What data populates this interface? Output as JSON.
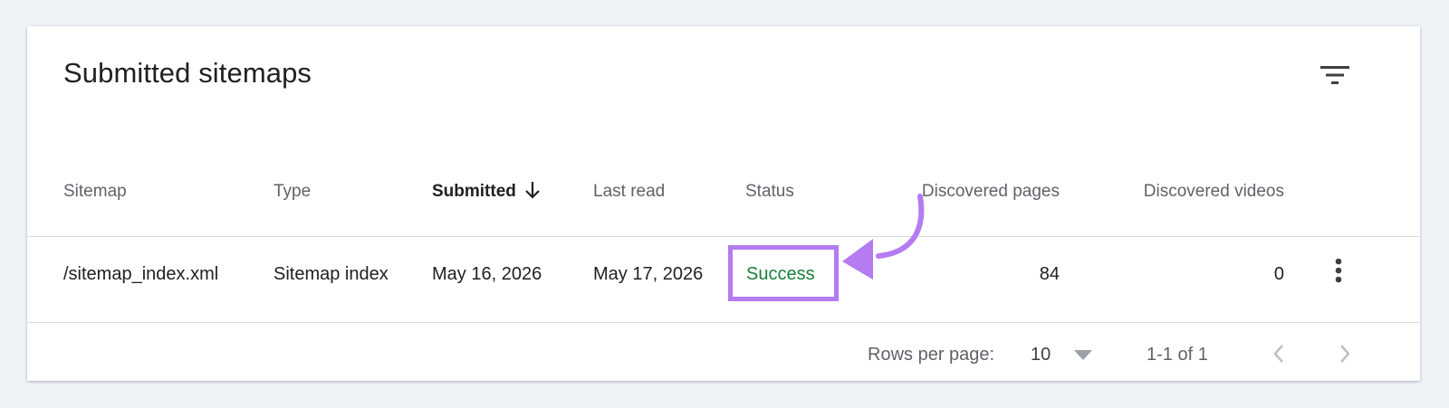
{
  "card": {
    "title": "Submitted sitemaps",
    "filter_icon": "filter-list-icon"
  },
  "table": {
    "columns": [
      {
        "label": "Sitemap"
      },
      {
        "label": "Type"
      },
      {
        "label": "Submitted",
        "sorted": "descending"
      },
      {
        "label": "Last read"
      },
      {
        "label": "Status"
      },
      {
        "label": "Discovered pages"
      },
      {
        "label": "Discovered videos"
      }
    ],
    "rows": [
      {
        "sitemap": "/sitemap_index.xml",
        "type": "Sitemap index",
        "submitted": "May 16, 2026",
        "last_read": "May 17, 2026",
        "status": "Success",
        "discovered_pages": "84",
        "discovered_videos": "0"
      }
    ]
  },
  "pagination": {
    "rows_per_page_label": "Rows per page:",
    "rows_per_page_value": "10",
    "range": "1-1 of 1"
  },
  "colors": {
    "status_success": "#188038",
    "highlight": "#b57bf0",
    "background": "#eff2f7"
  }
}
